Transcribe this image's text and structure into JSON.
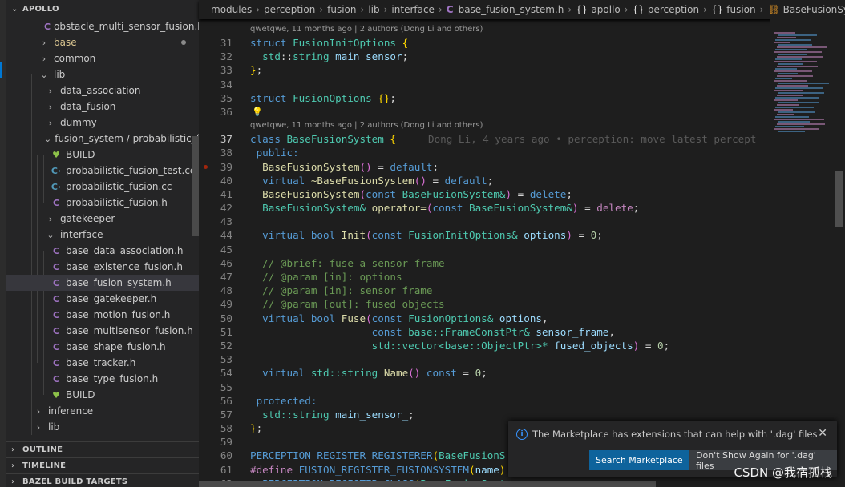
{
  "sidebar": {
    "root": "APOLLO",
    "items": [
      {
        "label": "obstacle_multi_sensor_fusion.h",
        "icon": "c-header-icon",
        "indent": 47,
        "color": "#cccccc"
      },
      {
        "label": "base",
        "icon": "chevron-right-icon",
        "indent": 39,
        "color": "#d7c38e",
        "modified": true
      },
      {
        "label": "common",
        "icon": "chevron-right-icon",
        "indent": 39,
        "color": "#cccccc"
      },
      {
        "label": "lib",
        "icon": "chevron-down-icon",
        "indent": 39,
        "color": "#cccccc"
      },
      {
        "label": "data_association",
        "icon": "chevron-right-icon",
        "indent": 47,
        "color": "#cccccc"
      },
      {
        "label": "data_fusion",
        "icon": "chevron-right-icon",
        "indent": 47,
        "color": "#cccccc"
      },
      {
        "label": "dummy",
        "icon": "chevron-right-icon",
        "indent": 47,
        "color": "#cccccc"
      },
      {
        "label": "fusion_system / probabilistic_fu...",
        "icon": "chevron-down-icon",
        "indent": 47,
        "color": "#cccccc"
      },
      {
        "label": "BUILD",
        "icon": "build-icon",
        "indent": 54,
        "color": "#cccccc"
      },
      {
        "label": "probabilistic_fusion_test.cc",
        "icon": "cpp-file-icon",
        "indent": 54,
        "color": "#cccccc"
      },
      {
        "label": "probabilistic_fusion.cc",
        "icon": "cpp-file-icon",
        "indent": 54,
        "color": "#cccccc"
      },
      {
        "label": "probabilistic_fusion.h",
        "icon": "c-header-icon",
        "indent": 54,
        "color": "#cccccc"
      },
      {
        "label": "gatekeeper",
        "icon": "chevron-right-icon",
        "indent": 47,
        "color": "#cccccc"
      },
      {
        "label": "interface",
        "icon": "chevron-down-icon",
        "indent": 47,
        "color": "#cccccc"
      },
      {
        "label": "base_data_association.h",
        "icon": "c-header-icon",
        "indent": 54,
        "color": "#cccccc"
      },
      {
        "label": "base_existence_fusion.h",
        "icon": "c-header-icon",
        "indent": 54,
        "color": "#cccccc"
      },
      {
        "label": "base_fusion_system.h",
        "icon": "c-header-icon",
        "indent": 54,
        "color": "#cccccc",
        "selected": true
      },
      {
        "label": "base_gatekeeper.h",
        "icon": "c-header-icon",
        "indent": 54,
        "color": "#cccccc"
      },
      {
        "label": "base_motion_fusion.h",
        "icon": "c-header-icon",
        "indent": 54,
        "color": "#cccccc"
      },
      {
        "label": "base_multisensor_fusion.h",
        "icon": "c-header-icon",
        "indent": 54,
        "color": "#cccccc"
      },
      {
        "label": "base_shape_fusion.h",
        "icon": "c-header-icon",
        "indent": 54,
        "color": "#cccccc"
      },
      {
        "label": "base_tracker.h",
        "icon": "c-header-icon",
        "indent": 54,
        "color": "#cccccc"
      },
      {
        "label": "base_type_fusion.h",
        "icon": "c-header-icon",
        "indent": 54,
        "color": "#cccccc"
      },
      {
        "label": "BUILD",
        "icon": "build-icon",
        "indent": 54,
        "color": "#cccccc"
      },
      {
        "label": "inference",
        "icon": "chevron-right-icon",
        "indent": 32,
        "color": "#cccccc"
      },
      {
        "label": "lib",
        "icon": "chevron-right-icon",
        "indent": 32,
        "color": "#cccccc"
      }
    ],
    "sections": [
      "OUTLINE",
      "TIMELINE",
      "BAZEL BUILD TARGETS"
    ]
  },
  "breadcrumb": {
    "path": [
      "modules",
      "perception",
      "fusion",
      "lib",
      "interface"
    ],
    "file": "base_fusion_system.h",
    "namespaces": [
      "apollo",
      "perception",
      "fusion"
    ],
    "symbol": "BaseFusionSystem"
  },
  "editor": {
    "codelens": "qwetqwe, 11 months ago | 2 authors (Dong Li and others)",
    "blame": "Dong Li, 4 years ago • perception: move latest percept",
    "lines": [
      {
        "n": 31,
        "lens": true,
        "tokens": [
          [
            "struct",
            "k"
          ],
          [
            " ",
            "p"
          ],
          [
            "FusionInitOptions",
            "t"
          ],
          [
            " ",
            "p"
          ],
          [
            "{",
            "b"
          ]
        ]
      },
      {
        "n": 32,
        "tokens": [
          [
            "  std",
            "t"
          ],
          [
            "::",
            "p"
          ],
          [
            "string",
            "t"
          ],
          [
            " main_sensor",
            "v"
          ],
          [
            ";",
            "p"
          ]
        ]
      },
      {
        "n": 33,
        "tokens": [
          [
            "}",
            "b"
          ],
          [
            ";",
            "p"
          ]
        ]
      },
      {
        "n": 34,
        "tokens": []
      },
      {
        "n": 35,
        "tokens": [
          [
            "struct",
            "k"
          ],
          [
            " FusionOptions",
            "t"
          ],
          [
            " {}",
            "b"
          ],
          [
            ";",
            "p"
          ]
        ]
      },
      {
        "n": 36,
        "bulb": true,
        "tokens": []
      },
      {
        "n": 37,
        "lens": true,
        "current": true,
        "blame": true,
        "tokens": [
          [
            "class",
            "k"
          ],
          [
            " BaseFusionSystem",
            "t"
          ],
          [
            " {",
            "b"
          ]
        ]
      },
      {
        "n": 38,
        "tokens": [
          [
            " public:",
            "k"
          ]
        ]
      },
      {
        "n": 39,
        "breakpoint": true,
        "tokens": [
          [
            "  BaseFusionSystem",
            "f"
          ],
          [
            "()",
            "r"
          ],
          [
            " = ",
            "p"
          ],
          [
            "default",
            "k"
          ],
          [
            ";",
            "p"
          ]
        ]
      },
      {
        "n": 40,
        "tokens": [
          [
            "  virtual",
            "k"
          ],
          [
            " ~BaseFusionSystem",
            "f"
          ],
          [
            "()",
            "r"
          ],
          [
            " = ",
            "p"
          ],
          [
            "default",
            "k"
          ],
          [
            ";",
            "p"
          ]
        ]
      },
      {
        "n": 41,
        "tokens": [
          [
            "  BaseFusionSystem",
            "f"
          ],
          [
            "(",
            "r"
          ],
          [
            "const",
            "k"
          ],
          [
            " BaseFusionSystem&",
            "t"
          ],
          [
            ")",
            "r"
          ],
          [
            " = ",
            "p"
          ],
          [
            "delete",
            "k"
          ],
          [
            ";",
            "p"
          ]
        ]
      },
      {
        "n": 42,
        "tokens": [
          [
            "  BaseFusionSystem&",
            "t"
          ],
          [
            " operator=",
            "f"
          ],
          [
            "(",
            "r"
          ],
          [
            "const",
            "k"
          ],
          [
            " BaseFusionSystem&",
            "t"
          ],
          [
            ")",
            "r"
          ],
          [
            " = ",
            "p"
          ],
          [
            "delete",
            "d"
          ],
          [
            ";",
            "p"
          ]
        ]
      },
      {
        "n": 43,
        "tokens": []
      },
      {
        "n": 44,
        "tokens": [
          [
            "  virtual bool",
            "k"
          ],
          [
            " Init",
            "f"
          ],
          [
            "(",
            "r"
          ],
          [
            "const",
            "k"
          ],
          [
            " FusionInitOptions&",
            "t"
          ],
          [
            " options",
            "v"
          ],
          [
            ")",
            "r"
          ],
          [
            " = ",
            "p"
          ],
          [
            "0",
            "n"
          ],
          [
            ";",
            "p"
          ]
        ]
      },
      {
        "n": 45,
        "tokens": []
      },
      {
        "n": 46,
        "tokens": [
          [
            "  // @brief: fuse a sensor frame",
            "c"
          ]
        ]
      },
      {
        "n": 47,
        "tokens": [
          [
            "  // @param [in]: options",
            "c"
          ]
        ]
      },
      {
        "n": 48,
        "tokens": [
          [
            "  // @param [in]: sensor_frame",
            "c"
          ]
        ]
      },
      {
        "n": 49,
        "tokens": [
          [
            "  // @param [out]: fused objects",
            "c"
          ]
        ]
      },
      {
        "n": 50,
        "tokens": [
          [
            "  virtual bool",
            "k"
          ],
          [
            " Fuse",
            "f"
          ],
          [
            "(",
            "r"
          ],
          [
            "const",
            "k"
          ],
          [
            " FusionOptions&",
            "t"
          ],
          [
            " options",
            "v"
          ],
          [
            ",",
            "p"
          ]
        ]
      },
      {
        "n": 51,
        "tokens": [
          [
            "                    const",
            "k"
          ],
          [
            " base::FrameConstPtr&",
            "t"
          ],
          [
            " sensor_frame",
            "v"
          ],
          [
            ",",
            "p"
          ]
        ]
      },
      {
        "n": 52,
        "tokens": [
          [
            "                    std::vector<base::ObjectPtr>*",
            "t"
          ],
          [
            " fused_objects",
            "v"
          ],
          [
            ")",
            "r"
          ],
          [
            " = ",
            "p"
          ],
          [
            "0",
            "n"
          ],
          [
            ";",
            "p"
          ]
        ]
      },
      {
        "n": 53,
        "tokens": []
      },
      {
        "n": 54,
        "tokens": [
          [
            "  virtual",
            "k"
          ],
          [
            " std::string",
            "t"
          ],
          [
            " Name",
            "f"
          ],
          [
            "()",
            "r"
          ],
          [
            " const",
            "k"
          ],
          [
            " = ",
            "p"
          ],
          [
            "0",
            "n"
          ],
          [
            ";",
            "p"
          ]
        ]
      },
      {
        "n": 55,
        "tokens": []
      },
      {
        "n": 56,
        "tokens": [
          [
            " protected:",
            "k"
          ]
        ]
      },
      {
        "n": 57,
        "tokens": [
          [
            "  std::string",
            "t"
          ],
          [
            " main_sensor_",
            "v"
          ],
          [
            ";",
            "p"
          ]
        ]
      },
      {
        "n": 58,
        "tokens": [
          [
            "}",
            "b"
          ],
          [
            ";",
            "p"
          ]
        ]
      },
      {
        "n": 59,
        "tokens": []
      },
      {
        "n": 60,
        "tokens": [
          [
            "PERCEPTION_REGISTER_REGISTERER",
            "m"
          ],
          [
            "(",
            "b"
          ],
          [
            "BaseFusionS",
            "t"
          ]
        ]
      },
      {
        "n": 61,
        "tokens": [
          [
            "#define",
            "d"
          ],
          [
            " FUSION_REGISTER_FUSIONSYSTEM",
            "m"
          ],
          [
            "(",
            "b"
          ],
          [
            "name",
            "v"
          ],
          [
            ")",
            "b"
          ]
        ]
      },
      {
        "n": 62,
        "tokens": [
          [
            "  PERCEPTION_REGISTER_CLASS",
            "m"
          ],
          [
            "(",
            "b"
          ],
          [
            "BaseFusionSyst",
            "t"
          ]
        ]
      }
    ]
  },
  "notification": {
    "message": "The Marketplace has extensions that can help with '.dag' files",
    "primary_button": "Search Marketplace",
    "secondary_button": "Don't Show Again for '.dag' files"
  },
  "watermark": "CSDN @我宿孤栈"
}
